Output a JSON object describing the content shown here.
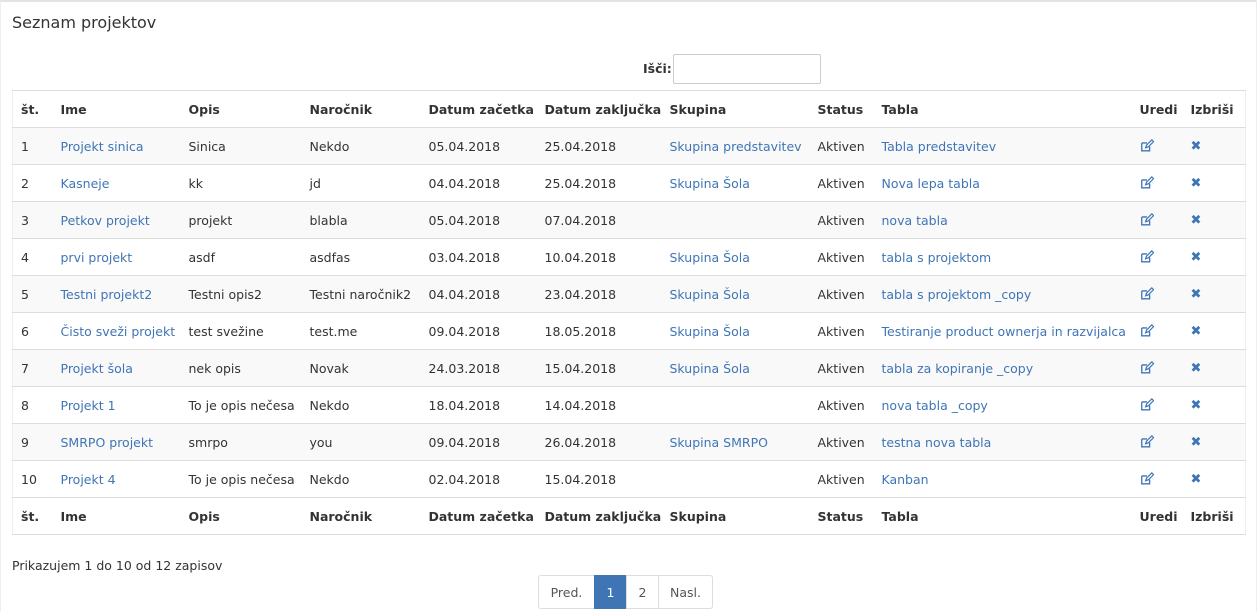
{
  "page": {
    "title": "Seznam projektov"
  },
  "search": {
    "label": "Išči:",
    "value": "",
    "placeholder": ""
  },
  "columns": [
    "št.",
    "Ime",
    "Opis",
    "Naročnik",
    "Datum začetka",
    "Datum zaključka",
    "Skupina",
    "Status",
    "Tabla",
    "Uredi",
    "Izbriši"
  ],
  "rows": [
    {
      "num": "1",
      "name": "Projekt sinica",
      "desc": "Sinica",
      "client": "Nekdo",
      "start": "05.04.2018",
      "end": "25.04.2018",
      "group": "Skupina predstavitev",
      "status": "Aktiven",
      "board": "Tabla predstavitev"
    },
    {
      "num": "2",
      "name": "Kasneje",
      "desc": "kk",
      "client": "jd",
      "start": "04.04.2018",
      "end": "25.04.2018",
      "group": "Skupina Šola",
      "status": "Aktiven",
      "board": "Nova lepa tabla"
    },
    {
      "num": "3",
      "name": "Petkov projekt",
      "desc": "projekt",
      "client": "blabla",
      "start": "05.04.2018",
      "end": "07.04.2018",
      "group": "",
      "status": "Aktiven",
      "board": "nova tabla"
    },
    {
      "num": "4",
      "name": "prvi projekt",
      "desc": "asdf",
      "client": "asdfas",
      "start": "03.04.2018",
      "end": "10.04.2018",
      "group": "Skupina Šola",
      "status": "Aktiven",
      "board": "tabla s projektom"
    },
    {
      "num": "5",
      "name": "Testni projekt2",
      "desc": "Testni opis2",
      "client": "Testni naročnik2",
      "start": "04.04.2018",
      "end": "23.04.2018",
      "group": "Skupina Šola",
      "status": "Aktiven",
      "board": "tabla s projektom _copy"
    },
    {
      "num": "6",
      "name": "Čisto sveži projekt",
      "desc": "test svežine",
      "client": "test.me",
      "start": "09.04.2018",
      "end": "18.05.2018",
      "group": "Skupina Šola",
      "status": "Aktiven",
      "board": "Testiranje product ownerja in razvijalca"
    },
    {
      "num": "7",
      "name": "Projekt šola",
      "desc": "nek opis",
      "client": "Novak",
      "start": "24.03.2018",
      "end": "15.04.2018",
      "group": "Skupina Šola",
      "status": "Aktiven",
      "board": "tabla za kopiranje _copy"
    },
    {
      "num": "8",
      "name": "Projekt 1",
      "desc": "To je opis nečesa",
      "client": "Nekdo",
      "start": "18.04.2018",
      "end": "14.04.2018",
      "group": "",
      "status": "Aktiven",
      "board": "nova tabla _copy"
    },
    {
      "num": "9",
      "name": "SMRPO projekt",
      "desc": "smrpo",
      "client": "you",
      "start": "09.04.2018",
      "end": "26.04.2018",
      "group": "Skupina SMRPO",
      "status": "Aktiven",
      "board": "testna nova tabla"
    },
    {
      "num": "10",
      "name": "Projekt 4",
      "desc": "To je opis nečesa",
      "client": "Nekdo",
      "start": "02.04.2018",
      "end": "15.04.2018",
      "group": "",
      "status": "Aktiven",
      "board": "Kanban"
    }
  ],
  "icons": {
    "edit": "edit-icon",
    "delete": "delete-icon",
    "delete_glyph": "✖",
    "link_color": "#3f75b5",
    "active_page_color": "#3f75b5"
  },
  "info": {
    "text": "Prikazujem 1 do 10 od 12 zapisov"
  },
  "pagination": {
    "prev": "Pred.",
    "pages": [
      "1",
      "2"
    ],
    "active": "1",
    "next": "Nasl."
  }
}
